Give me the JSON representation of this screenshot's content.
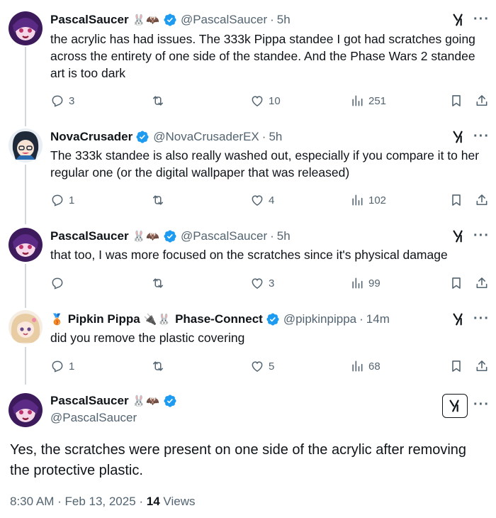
{
  "tweets": [
    {
      "name": "PascalSaucer",
      "emoji": "🐰🦇",
      "handle": "@PascalSaucer",
      "time": "5h",
      "text": "the acrylic has had issues. The 333k Pippa standee I got had scratches going across the entirety of one side of the standee. And the Phase Wars 2 standee art is too dark",
      "replies": "3",
      "retweets": "",
      "likes": "10",
      "views": "251"
    },
    {
      "name": "NovaCrusader",
      "emoji": "",
      "handle": "@NovaCrusaderEX",
      "time": "5h",
      "text": "The 333k standee is also really washed out, especially if you compare it to her regular one (or the digital wallpaper that was released)",
      "replies": "1",
      "retweets": "",
      "likes": "4",
      "views": "102"
    },
    {
      "name": "PascalSaucer",
      "emoji": "🐰🦇",
      "handle": "@PascalSaucer",
      "time": "5h",
      "text": "that too, I was more focused on the scratches since it's physical damage",
      "replies": "",
      "retweets": "",
      "likes": "3",
      "views": "99"
    },
    {
      "name": "Pipkin Pippa",
      "name_suffix": "Phase-Connect",
      "emoji_pre": "🥉",
      "emoji_mid": "🔌🐰",
      "handle": "@pipkinpippa",
      "time": "14m",
      "text": "did you remove the plastic covering",
      "replies": "1",
      "retweets": "",
      "likes": "5",
      "views": "68"
    }
  ],
  "main": {
    "name": "PascalSaucer",
    "emoji": "🐰🦇",
    "handle": "@PascalSaucer",
    "text": "Yes, the scratches were present on one side of the acrylic after removing the protective plastic.",
    "timestamp": "8:30 AM · Feb 13, 2025 · ",
    "views_count": "14",
    "views_label": " Views"
  },
  "colors": {
    "verified": "#1d9bf0",
    "text": "#0f1419",
    "muted": "#536471",
    "thread_line": "#cfd9de"
  },
  "icons": [
    "reply-icon",
    "retweet-icon",
    "like-icon",
    "views-icon",
    "bookmark-icon",
    "share-icon",
    "grok-icon",
    "more-icon",
    "verified-badge-icon"
  ]
}
